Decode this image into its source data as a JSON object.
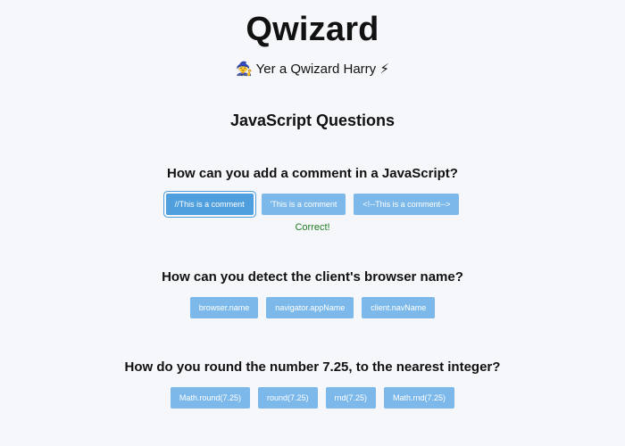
{
  "app": {
    "title": "Qwizard",
    "subtitle": "🧙 Yer a Qwizard Harry ⚡"
  },
  "section": {
    "title": "JavaScript Questions"
  },
  "questions": [
    {
      "text": "How can you add a comment in a JavaScript?",
      "options": [
        "//This is a comment",
        "'This is a comment",
        "<!--This is a comment-->"
      ],
      "selected_index": 0,
      "result": "Correct!"
    },
    {
      "text": "How can you detect the client's browser name?",
      "options": [
        "browser.name",
        "navigator.appName",
        "client.navName"
      ]
    },
    {
      "text": "How do you round the number 7.25, to the nearest integer?",
      "options": [
        "Math.round(7.25)",
        "round(7.25)",
        "rnd(7.25)",
        "Math.rnd(7.25)"
      ]
    }
  ],
  "colors": {
    "background": "#f6f7fb",
    "button": "#7cb9ea",
    "button_selected": "#4f9fde",
    "correct": "#1d7c1d"
  }
}
